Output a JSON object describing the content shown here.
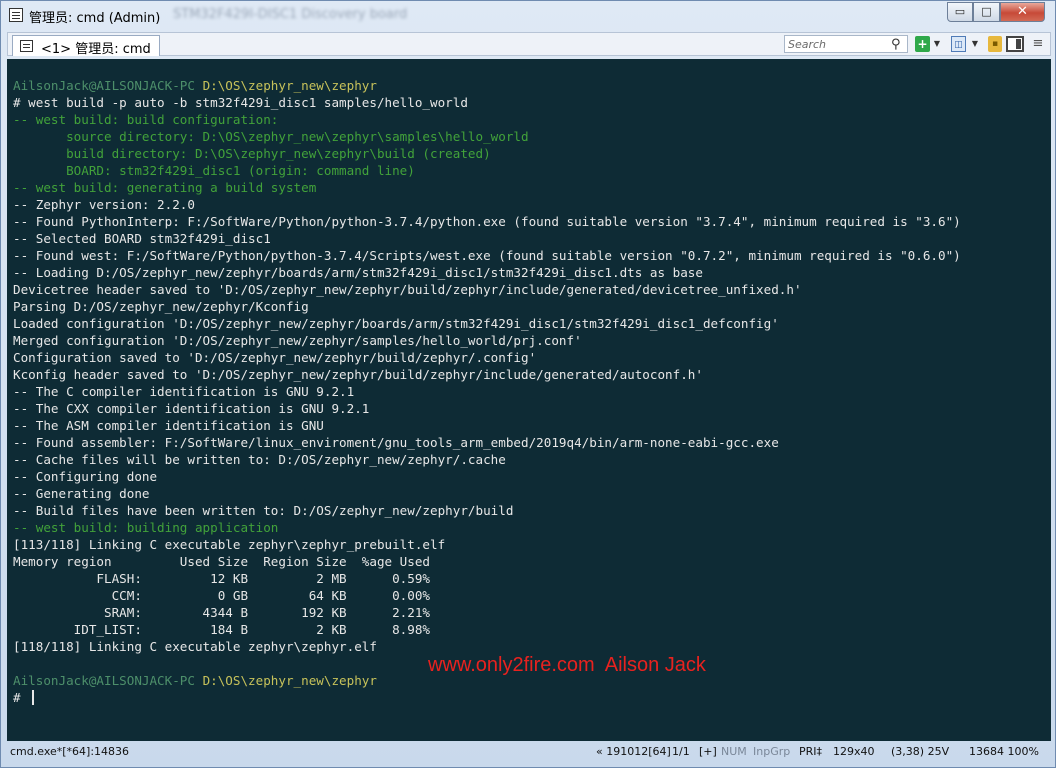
{
  "window": {
    "title": "管理员: cmd (Admin)",
    "title_obscured": "STM32F429I-DISC1 Discovery board",
    "minimize_glyph": "▭",
    "maximize_glyph": "□",
    "close_glyph": "✕"
  },
  "tabs": [
    {
      "label": "<1> 管理员: cmd"
    }
  ],
  "toolbar": {
    "search_placeholder": "Search",
    "search_glyph": "⚲",
    "add_glyph": "+",
    "dropdown_glyph": "▼",
    "view_glyph": "◫",
    "lock_glyph": "▪",
    "menu_glyph": "≡"
  },
  "console": {
    "lines": [
      {
        "segments": [
          {
            "text": "AilsonJack@AILSONJACK-PC ",
            "kind": "user"
          },
          {
            "text": "D:\\OS\\zephyr_new\\zephyr",
            "kind": "path"
          }
        ]
      },
      {
        "segments": [
          {
            "text": "# west build -p auto -b stm32f429i_disc1 samples/hello_world",
            "kind": "norm"
          }
        ]
      },
      {
        "segments": [
          {
            "text": "-- west build: build configuration:",
            "kind": "cfg"
          }
        ]
      },
      {
        "segments": [
          {
            "text": "       source directory: D:\\OS\\zephyr_new\\zephyr\\samples\\hello_world",
            "kind": "cfg"
          }
        ]
      },
      {
        "segments": [
          {
            "text": "       build directory: D:\\OS\\zephyr_new\\zephyr\\build (created)",
            "kind": "cfg"
          }
        ]
      },
      {
        "segments": [
          {
            "text": "       BOARD: stm32f429i_disc1 (origin: command line)",
            "kind": "cfg"
          }
        ]
      },
      {
        "segments": [
          {
            "text": "-- west build: generating a build system",
            "kind": "cfg"
          }
        ]
      },
      {
        "segments": [
          {
            "text": "-- Zephyr version: 2.2.0",
            "kind": "norm"
          }
        ]
      },
      {
        "segments": [
          {
            "text": "-- Found PythonInterp: F:/SoftWare/Python/python-3.7.4/python.exe (found suitable version \"3.7.4\", minimum required is \"3.6\")",
            "kind": "norm"
          }
        ]
      },
      {
        "segments": [
          {
            "text": "-- Selected BOARD stm32f429i_disc1",
            "kind": "norm"
          }
        ]
      },
      {
        "segments": [
          {
            "text": "-- Found west: F:/SoftWare/Python/python-3.7.4/Scripts/west.exe (found suitable version \"0.7.2\", minimum required is \"0.6.0\")",
            "kind": "norm"
          }
        ]
      },
      {
        "segments": [
          {
            "text": "-- Loading D:/OS/zephyr_new/zephyr/boards/arm/stm32f429i_disc1/stm32f429i_disc1.dts as base",
            "kind": "norm"
          }
        ]
      },
      {
        "segments": [
          {
            "text": "Devicetree header saved to 'D:/OS/zephyr_new/zephyr/build/zephyr/include/generated/devicetree_unfixed.h'",
            "kind": "norm"
          }
        ]
      },
      {
        "segments": [
          {
            "text": "Parsing D:/OS/zephyr_new/zephyr/Kconfig",
            "kind": "norm"
          }
        ]
      },
      {
        "segments": [
          {
            "text": "Loaded configuration 'D:/OS/zephyr_new/zephyr/boards/arm/stm32f429i_disc1/stm32f429i_disc1_defconfig'",
            "kind": "norm"
          }
        ]
      },
      {
        "segments": [
          {
            "text": "Merged configuration 'D:/OS/zephyr_new/zephyr/samples/hello_world/prj.conf'",
            "kind": "norm"
          }
        ]
      },
      {
        "segments": [
          {
            "text": "Configuration saved to 'D:/OS/zephyr_new/zephyr/build/zephyr/.config'",
            "kind": "norm"
          }
        ]
      },
      {
        "segments": [
          {
            "text": "Kconfig header saved to 'D:/OS/zephyr_new/zephyr/build/zephyr/include/generated/autoconf.h'",
            "kind": "norm"
          }
        ]
      },
      {
        "segments": [
          {
            "text": "-- The C compiler identification is GNU 9.2.1",
            "kind": "norm"
          }
        ]
      },
      {
        "segments": [
          {
            "text": "-- The CXX compiler identification is GNU 9.2.1",
            "kind": "norm"
          }
        ]
      },
      {
        "segments": [
          {
            "text": "-- The ASM compiler identification is GNU",
            "kind": "norm"
          }
        ]
      },
      {
        "segments": [
          {
            "text": "-- Found assembler: F:/SoftWare/linux_enviroment/gnu_tools_arm_embed/2019q4/bin/arm-none-eabi-gcc.exe",
            "kind": "norm"
          }
        ]
      },
      {
        "segments": [
          {
            "text": "-- Cache files will be written to: D:/OS/zephyr_new/zephyr/.cache",
            "kind": "norm"
          }
        ]
      },
      {
        "segments": [
          {
            "text": "-- Configuring done",
            "kind": "norm"
          }
        ]
      },
      {
        "segments": [
          {
            "text": "-- Generating done",
            "kind": "norm"
          }
        ]
      },
      {
        "segments": [
          {
            "text": "-- Build files have been written to: D:/OS/zephyr_new/zephyr/build",
            "kind": "norm"
          }
        ]
      },
      {
        "segments": [
          {
            "text": "-- west build: building application",
            "kind": "cfg"
          }
        ]
      },
      {
        "segments": [
          {
            "text": "[113/118] Linking C executable zephyr\\zephyr_prebuilt.elf",
            "kind": "norm"
          }
        ]
      },
      {
        "segments": [
          {
            "text": "Memory region         Used Size  Region Size  %age Used",
            "kind": "norm"
          }
        ]
      },
      {
        "segments": [
          {
            "text": "           FLASH:         12 KB         2 MB      0.59%",
            "kind": "norm"
          }
        ]
      },
      {
        "segments": [
          {
            "text": "             CCM:          0 GB        64 KB      0.00%",
            "kind": "norm"
          }
        ]
      },
      {
        "segments": [
          {
            "text": "            SRAM:        4344 B       192 KB      2.21%",
            "kind": "norm"
          }
        ]
      },
      {
        "segments": [
          {
            "text": "        IDT_LIST:         184 B         2 KB      8.98%",
            "kind": "norm"
          }
        ]
      },
      {
        "segments": [
          {
            "text": "[118/118] Linking C executable zephyr\\zephyr.elf",
            "kind": "norm"
          }
        ]
      },
      {
        "segments": [
          {
            "text": "",
            "kind": "norm"
          }
        ]
      },
      {
        "segments": [
          {
            "text": "AilsonJack@AILSONJACK-PC ",
            "kind": "user"
          },
          {
            "text": "D:\\OS\\zephyr_new\\zephyr",
            "kind": "path"
          }
        ]
      },
      {
        "segments": [
          {
            "text": "# ",
            "kind": "norm"
          }
        ],
        "cursor": true
      }
    ],
    "watermark": "www.only2fire.com  Ailson Jack"
  },
  "statusbar": {
    "process": "cmd.exe*[*64]:14836",
    "position": "« 191012[64]",
    "tab_index": "1/1",
    "plus": "[+]",
    "num": "NUM",
    "inpgrp": "InpGrp",
    "priority": "PRI‡",
    "size": "129x40",
    "cursor": "(3,38) 25V",
    "memory": "13684 100%"
  },
  "colors": {
    "console_bg": "#0e2b35",
    "console_fg": "#e7e7e7",
    "prompt_user": "#4d8f6a",
    "prompt_path": "#c7c25a",
    "cfg_text": "#42a23a",
    "watermark": "#e8221f"
  }
}
